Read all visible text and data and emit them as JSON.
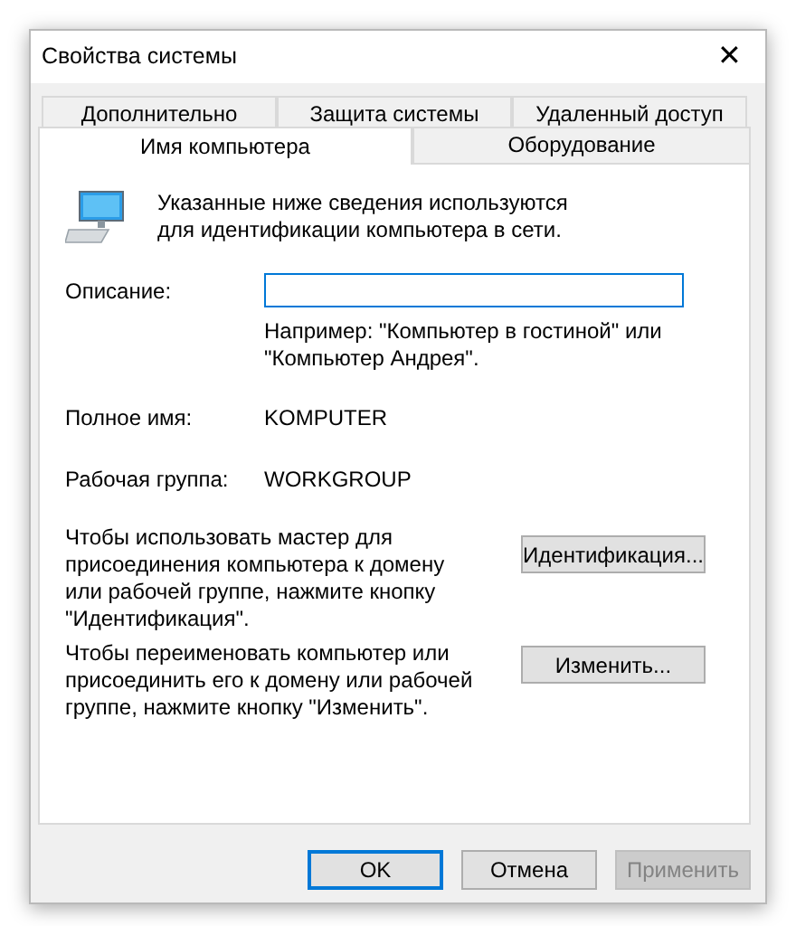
{
  "window": {
    "title": "Свойства системы",
    "close": "✕"
  },
  "tab_rows": [
    {
      "tabs": [
        {
          "label": "Дополнительно",
          "selected": false
        },
        {
          "label": "Защита системы",
          "selected": false
        },
        {
          "label": "Удаленный доступ",
          "selected": false
        }
      ]
    },
    {
      "tabs": [
        {
          "label": "Имя компьютера",
          "selected": true
        },
        {
          "label": "Оборудование",
          "selected": false
        }
      ]
    }
  ],
  "intro": "Указанные ниже сведения используются для идентификации компьютера в сети.",
  "description": {
    "label": "Описание:",
    "hint": "Например: \"Компьютер в гостиной\" или \"Компьютер Андрея\"."
  },
  "info": [
    {
      "label": "Полное имя:",
      "value": "KOMPUTER"
    },
    {
      "label": "Рабочая группа:",
      "value": "WORKGROUP"
    }
  ],
  "actions": [
    {
      "text": "Чтобы использовать мастер для присоединения компьютера к домену или рабочей группе, нажмите кнопку \"Идентификация\".",
      "button": "Идентификация..."
    },
    {
      "text": "Чтобы переименовать компьютер или присоединить его к домену или рабочей группе, нажмите кнопку \"Изменить\".",
      "button": "Изменить..."
    }
  ],
  "buttons": [
    {
      "label": "OK",
      "default": true,
      "disabled": false
    },
    {
      "label": "Отмена",
      "default": false,
      "disabled": false
    },
    {
      "label": "Применить",
      "default": false,
      "disabled": true
    }
  ]
}
